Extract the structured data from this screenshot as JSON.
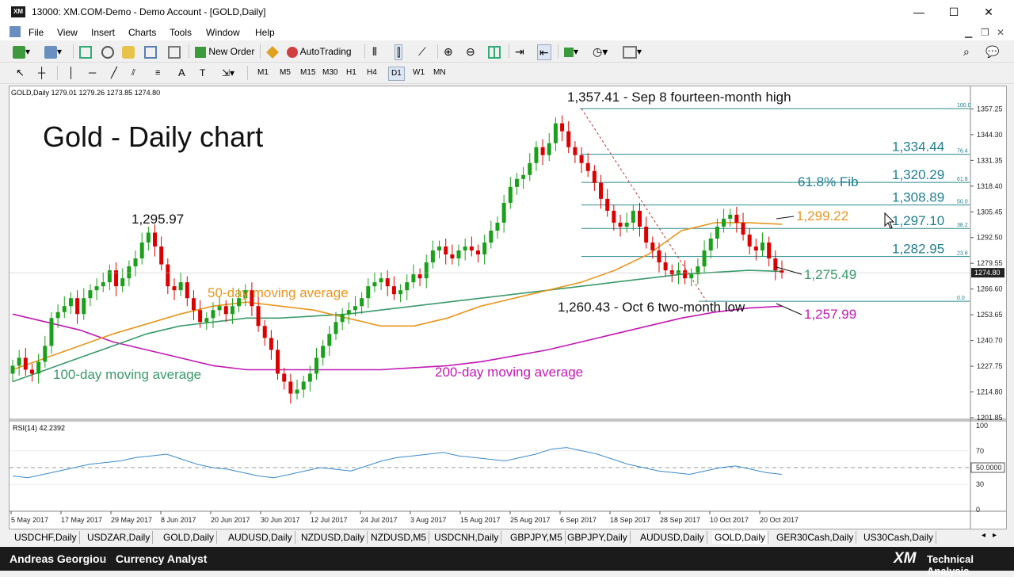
{
  "window": {
    "title": "13000: XM.COM-Demo - Demo Account - [GOLD,Daily]",
    "app_icon_text": "XM",
    "minimize": "—",
    "maximize": "☐",
    "close": "✕"
  },
  "menu": [
    "File",
    "View",
    "Insert",
    "Charts",
    "Tools",
    "Window",
    "Help"
  ],
  "toolbar": {
    "new_order_label": "New Order",
    "autotrading_label": "AutoTrading"
  },
  "periods": [
    "M1",
    "M5",
    "M15",
    "M30",
    "H1",
    "H4",
    "D1",
    "W1",
    "MN"
  ],
  "active_period": "D1",
  "chart_header": "GOLD,Daily  1279.01 1279.26 1273.85 1274.80",
  "chart_title": "Gold - Daily chart",
  "annotations": {
    "high": "1,357.41 - Sep 8 fourteen-month high",
    "low": "1,260.43 - Oct 6 two-month low",
    "swing_high": "1,295.97",
    "ma50_label": "50-day moving average",
    "ma100_label": "100-day moving average",
    "ma200_label": "200-day moving average",
    "fib_label": "61.8% Fib",
    "ma50_value": "1,299.22",
    "ma100_value": "1,275.49",
    "ma200_value": "1,257.99"
  },
  "fib_levels": [
    {
      "label": "",
      "pct": "100.0",
      "value": 1357.41
    },
    {
      "label": "1,334.44",
      "pct": "76.4",
      "value": 1334.44
    },
    {
      "label": "1,320.29",
      "pct": "61.8",
      "value": 1320.29
    },
    {
      "label": "1,308.89",
      "pct": "50.0",
      "value": 1308.89
    },
    {
      "label": "1,297.10",
      "pct": "38.2",
      "value": 1297.1
    },
    {
      "label": "1,282.95",
      "pct": "23.6",
      "value": 1282.95
    },
    {
      "label": "",
      "pct": "0.0",
      "value": 1260.43
    }
  ],
  "price_axis_ticks": [
    "1357.25",
    "1344.30",
    "1331.35",
    "1318.40",
    "1305.45",
    "1292.50",
    "1279.55",
    "1266.60",
    "1253.65",
    "1240.70",
    "1227.75",
    "1214.80",
    "1201.85"
  ],
  "current_price_tag": "1274.80",
  "rsi": {
    "header": "RSI(14) 42.2392",
    "ticks": [
      "100",
      "70",
      "50.0000",
      "30",
      "0"
    ]
  },
  "date_labels": [
    "5 May 2017",
    "17 May 2017",
    "29 May 2017",
    "8 Jun 2017",
    "20 Jun 2017",
    "30 Jun 2017",
    "12 Jul 2017",
    "24 Jul 2017",
    "3 Aug 2017",
    "15 Aug 2017",
    "25 Aug 2017",
    "6 Sep 2017",
    "18 Sep 2017",
    "28 Sep 2017",
    "10 Oct 2017",
    "20 Oct 2017"
  ],
  "tabs": [
    "USDCHF,Daily",
    "USDZAR,Daily",
    "GOLD,Daily",
    "AUDUSD,Daily",
    "NZDUSD,Daily",
    "NZDUSD,M5",
    "USDCNH,Daily",
    "GBPJPY,M5",
    "GBPJPY,Daily",
    "AUDUSD,Daily",
    "GOLD,Daily",
    "GER30Cash,Daily",
    "US30Cash,Daily"
  ],
  "active_tab_index": 10,
  "footer": {
    "author": "Andreas Georgiou",
    "role": "Currency Analyst",
    "brand": "XM",
    "brand_sub": "Technical Analysis"
  },
  "colors": {
    "up_candle": "#1aa01a",
    "down_candle": "#dd0000",
    "ma50": "#e8961e",
    "ma100": "#3a9a6a",
    "ma200": "#c218b4",
    "fib_line": "#2a8a8a",
    "fib_text": "#1f7f8f"
  },
  "chart_data": {
    "type": "candlestick",
    "symbol": "GOLD",
    "timeframe": "Daily",
    "ylim": [
      1201.85,
      1363.0
    ],
    "x_range": [
      "2017-05-05",
      "2017-10-23"
    ],
    "ohlc_close_estimates": [
      1228,
      1232,
      1226,
      1224,
      1230,
      1238,
      1252,
      1255,
      1258,
      1262,
      1254,
      1262,
      1266,
      1268,
      1270,
      1276,
      1268,
      1272,
      1278,
      1282,
      1290,
      1295,
      1288,
      1279,
      1268,
      1266,
      1270,
      1262,
      1256,
      1250,
      1252,
      1256,
      1258,
      1254,
      1258,
      1262,
      1266,
      1258,
      1248,
      1242,
      1236,
      1224,
      1220,
      1214,
      1216,
      1220,
      1224,
      1232,
      1238,
      1244,
      1250,
      1254,
      1256,
      1258,
      1262,
      1268,
      1270,
      1272,
      1268,
      1264,
      1266,
      1270,
      1274,
      1272,
      1280,
      1286,
      1288,
      1284,
      1282,
      1286,
      1288,
      1286,
      1284,
      1290,
      1296,
      1300,
      1310,
      1318,
      1322,
      1324,
      1330,
      1338,
      1334,
      1340,
      1350,
      1346,
      1338,
      1334,
      1330,
      1326,
      1320,
      1312,
      1306,
      1300,
      1298,
      1300,
      1306,
      1298,
      1290,
      1286,
      1280,
      1276,
      1274,
      1276,
      1272,
      1274,
      1278,
      1286,
      1292,
      1298,
      1302,
      1304,
      1300,
      1294,
      1288,
      1286,
      1290,
      1282,
      1276,
      1274.8
    ],
    "ma50": [
      1226,
      1232,
      1238,
      1244,
      1249,
      1254,
      1258,
      1260,
      1258,
      1256,
      1252,
      1248,
      1248,
      1252,
      1258,
      1262,
      1266,
      1270,
      1276,
      1284,
      1296,
      1300,
      1300,
      1299.22
    ],
    "ma100": [
      1220,
      1226,
      1232,
      1238,
      1244,
      1248,
      1250,
      1252,
      1252,
      1253,
      1254,
      1256,
      1258,
      1260,
      1262,
      1264,
      1266,
      1268,
      1270,
      1272,
      1274,
      1275,
      1276,
      1275.49
    ],
    "ma200": [
      1254,
      1250,
      1246,
      1240,
      1236,
      1232,
      1228,
      1226,
      1226,
      1226,
      1226,
      1226,
      1227,
      1228,
      1230,
      1233,
      1236,
      1240,
      1244,
      1248,
      1252,
      1255,
      1257,
      1257.99
    ],
    "rsi_values": [
      40,
      38,
      42,
      46,
      50,
      54,
      56,
      58,
      62,
      64,
      66,
      60,
      54,
      50,
      48,
      44,
      40,
      38,
      42,
      46,
      50,
      48,
      46,
      52,
      58,
      62,
      64,
      66,
      68,
      64,
      62,
      60,
      58,
      62,
      66,
      72,
      74,
      70,
      66,
      60,
      54,
      50,
      46,
      44,
      42,
      46,
      50,
      52,
      48,
      44,
      42
    ],
    "rsi_ylim": [
      0,
      100
    ]
  }
}
